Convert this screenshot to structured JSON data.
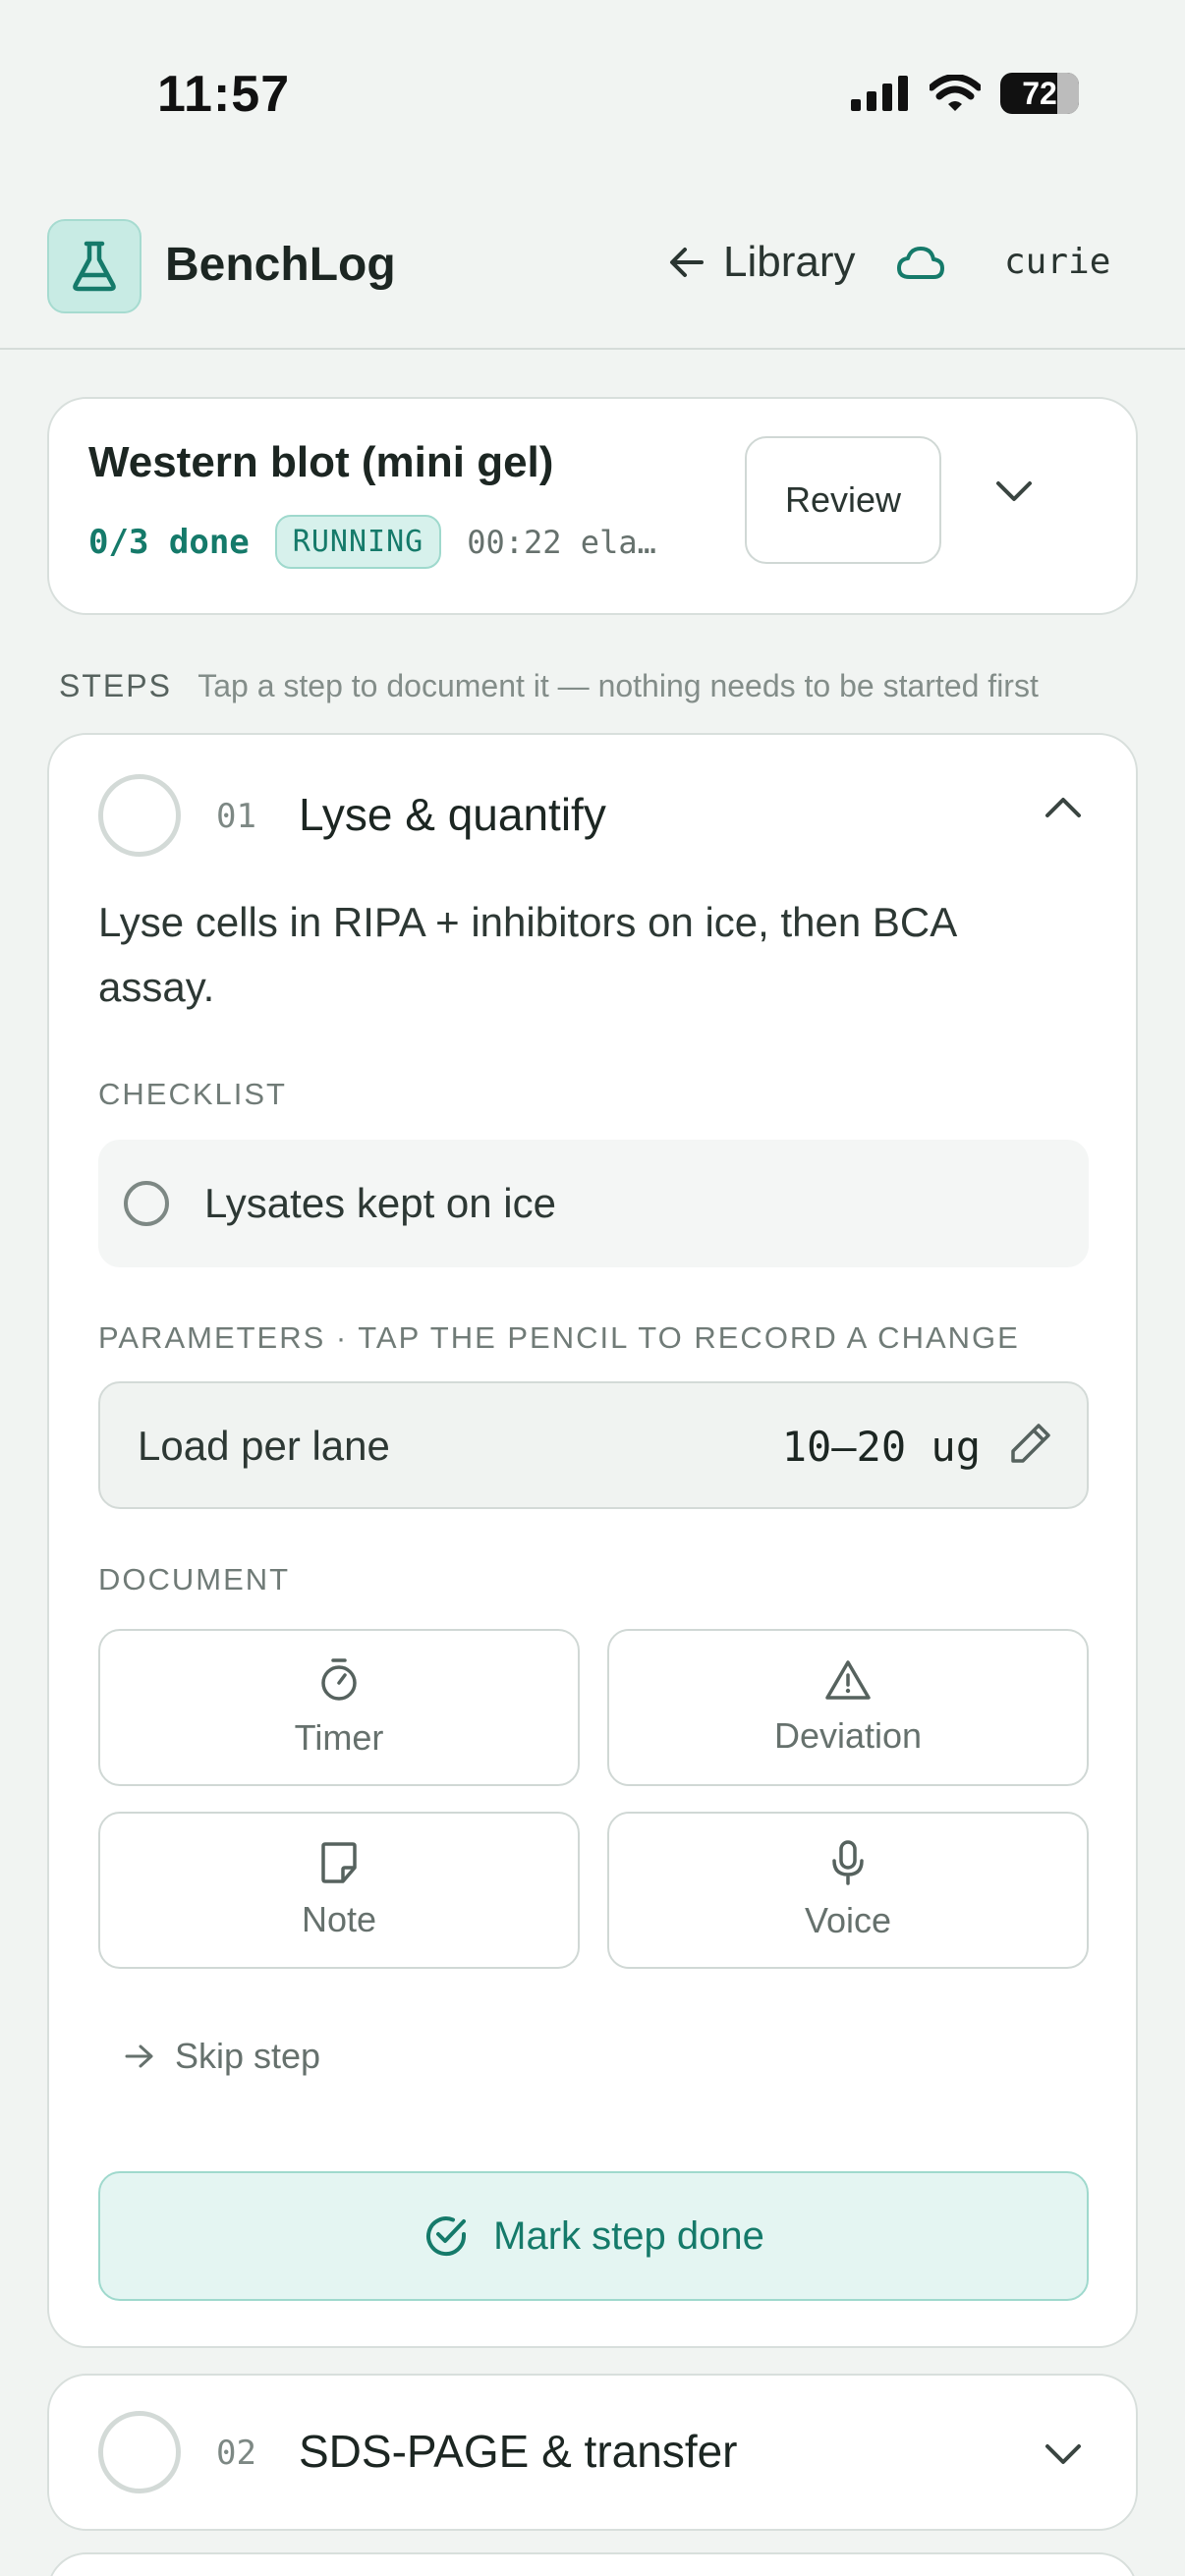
{
  "status": {
    "time": "11:57",
    "battery": "72"
  },
  "header": {
    "app_name": "BenchLog",
    "library_label": "Library",
    "user": "curie"
  },
  "run": {
    "title": "Western blot (mini gel)",
    "done": "0/3 done",
    "status": "RUNNING",
    "elapsed": "00:22 ela…",
    "review_label": "Review"
  },
  "steps_header": {
    "label": "STEPS",
    "hint": "Tap a step to document it — nothing needs to be started first"
  },
  "steps": [
    {
      "number": "01",
      "title": "Lyse & quantify",
      "description": "Lyse cells in RIPA + inhibitors on ice, then BCA assay.",
      "checklist_label": "CHECKLIST",
      "checklist": [
        {
          "label": "Lysates kept on ice",
          "checked": false
        }
      ],
      "parameters_label": "PARAMETERS · TAP THE PENCIL TO RECORD A CHANGE",
      "parameters": [
        {
          "name": "Load per lane",
          "value": "10–20 ug"
        }
      ],
      "document_label": "DOCUMENT",
      "document_actions": {
        "timer": "Timer",
        "deviation": "Deviation",
        "note": "Note",
        "voice": "Voice"
      },
      "skip_label": "Skip step",
      "done_label": "Mark step done"
    },
    {
      "number": "02",
      "title": "SDS-PAGE & transfer"
    }
  ],
  "colors": {
    "accent": "#157a6a",
    "accent_light": "#e4f5f2",
    "background": "#f1f4f2"
  }
}
